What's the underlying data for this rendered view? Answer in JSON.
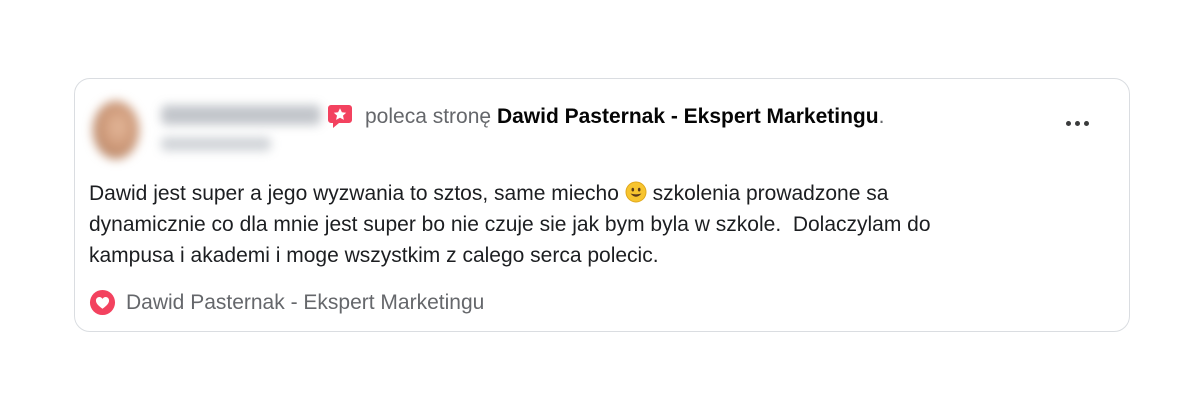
{
  "post": {
    "recommends_text": "poleca stronę",
    "page_name": "Dawid Pasternak - Ekspert Marketingu",
    "header_end": ".",
    "body_lines": [
      "Dawid jest super a jego wyzwania to sztos, same miecho",
      "szkolenia prowadzone sa",
      "dynamicznie co dla mnie jest super bo nie czuje sie jak bym byla w szkole.  Dolaczylam do",
      "kampusa i akademi i moge wszystkim z calego serca polecic."
    ],
    "footer_page_name": "Dawid Pasternak - Ekspert Marketingu"
  },
  "icons": {
    "recommend": "recommend-star-icon",
    "emoji": "smiling-face-emoji",
    "heart": "heart-icon",
    "more": "more-options-icon"
  },
  "colors": {
    "recommend_accent": "#f3425f",
    "heart_accent": "#f3425f",
    "secondary_text": "#65676b",
    "primary_text": "#050505",
    "card_border": "#dadde1"
  }
}
